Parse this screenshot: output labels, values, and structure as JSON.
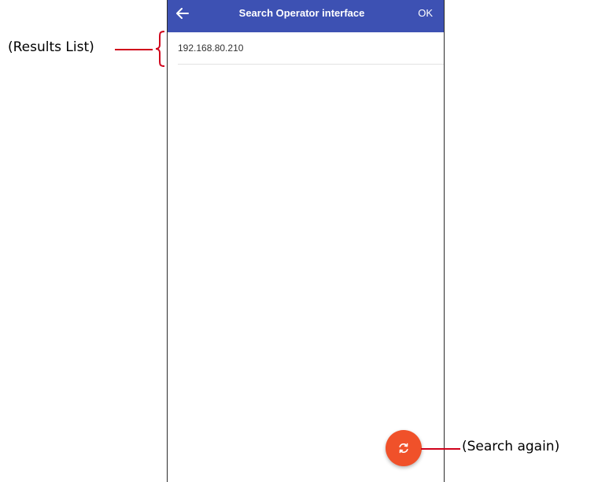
{
  "appbar": {
    "back_icon": "arrow-left-icon",
    "title": "Search Operator interface",
    "ok_label": "OK",
    "background_color": "#3d51b3"
  },
  "results": {
    "items": [
      {
        "label": "192.168.80.210"
      }
    ]
  },
  "fab": {
    "icon": "refresh-icon",
    "color": "#f0512a"
  },
  "annotations": {
    "results_list": "(Results List)",
    "search_again": "(Search again)",
    "line_color": "#d0021b"
  }
}
